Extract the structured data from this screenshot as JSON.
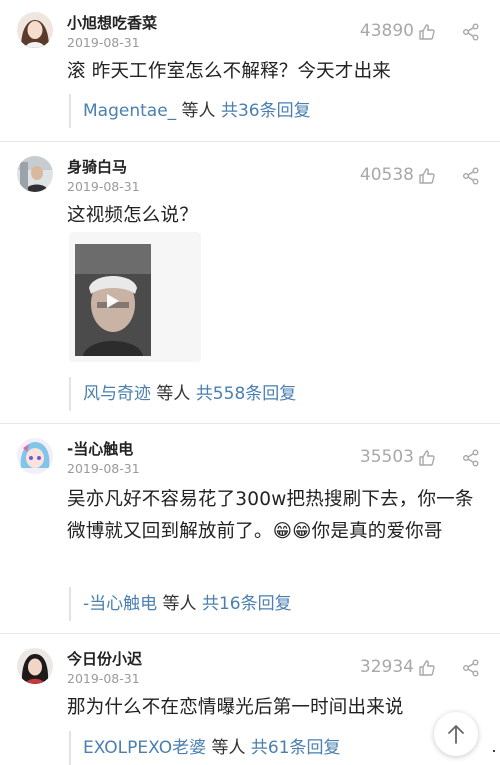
{
  "comments": [
    {
      "username": "小旭想吃香菜",
      "date": "2019-08-31",
      "likes": "43890",
      "text": "滚 昨天工作室怎么不解释？今天才出来",
      "reply_user": "Magentae_",
      "reply_mid": " 等人 ",
      "reply_count": "共36条回复"
    },
    {
      "username": "身骑白马",
      "date": "2019-08-31",
      "likes": "40538",
      "text": "这视频怎么说？",
      "reply_user": "风与奇迹",
      "reply_mid": " 等人 ",
      "reply_count": "共558条回复"
    },
    {
      "username": "-当心触电",
      "date": "2019-08-31",
      "likes": "35503",
      "text": "吴亦凡好不容易花了300w把热搜刷下去，你一条微博就又回到解放前了。😁😁你是真的爱你哥",
      "reply_user": "-当心触电",
      "reply_mid": " 等人 ",
      "reply_count": "共16条回复"
    },
    {
      "username": "今日份小迟",
      "date": "2019-08-31",
      "likes": "32934",
      "text": "那为什么不在恋情曝光后第一时间出来说",
      "reply_user": "EXOLPEXO老婆",
      "reply_mid": " 等人 ",
      "reply_count": "共61条回复"
    }
  ],
  "icons": {
    "like": "thumb-up-icon",
    "share": "share-icon",
    "scroll_top": "arrow-up-icon"
  },
  "colors": {
    "link": "#4a7fb0",
    "meta": "#9a9a9a"
  }
}
